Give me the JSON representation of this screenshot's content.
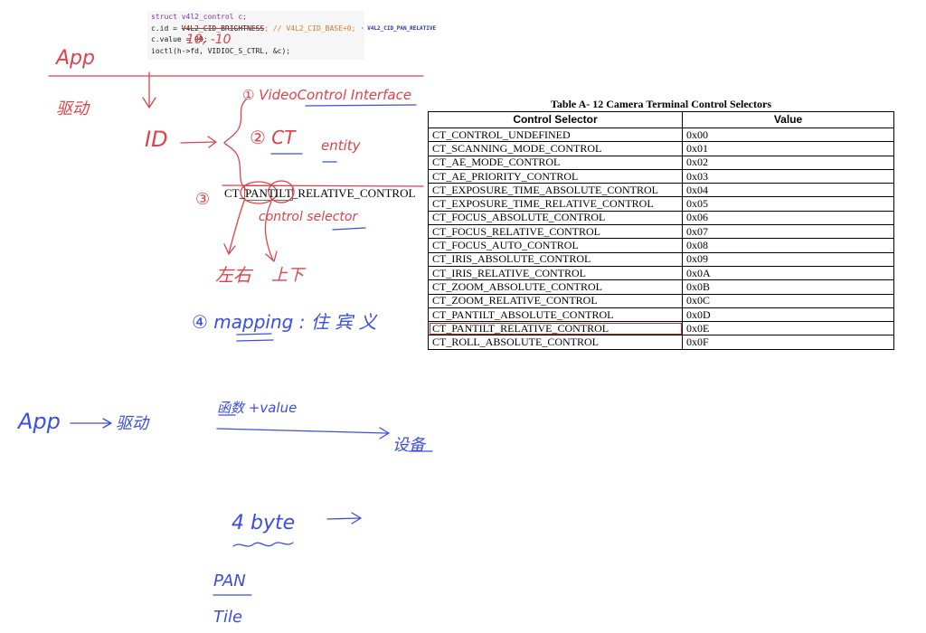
{
  "code": {
    "line1_kw": "struct v4l2_control c;",
    "line2_pre": "c.id = ",
    "line2_strike": "V4L2_CID_BRIGHTNESS",
    "line2_cmt": "; // V4L2_CID_BASE+0;",
    "line3_pre": "c.value = ",
    "line3_strike": "99",
    "line3_post": ";",
    "line4": "ioctl(h->fd, VIDIOC_S_CTRL, &c);"
  },
  "tag": "· V4L2_CID_PAN_RELATIVE",
  "handwriting": {
    "value_note": "10, -10",
    "app_top": "App",
    "driver": "驱动",
    "id": "ID",
    "vc_interface": "① VideoControl Interface",
    "ct_entity_num": "② CT",
    "entity": "entity",
    "num3": "③",
    "control_selector": "control selector",
    "left_right": "左右",
    "up_down": "上下",
    "mapping": "④ mapping : 住 宾 义",
    "app_bottom": "App",
    "driver_bottom": "驱动",
    "func_value": "函数 +value",
    "device": "设备",
    "four_byte": "4 byte",
    "pan": "PAN",
    "tilt": "Tile"
  },
  "ct_label": {
    "pre": "CT_",
    "boxed": "PANTILT",
    "post": "_RELATIVE_CONTROL"
  },
  "table": {
    "title": "Table A- 12 Camera Terminal Control Selectors",
    "headers": [
      "Control Selector",
      "Value"
    ],
    "rows": [
      [
        "CT_CONTROL_UNDEFINED",
        "0x00"
      ],
      [
        "CT_SCANNING_MODE_CONTROL",
        "0x01"
      ],
      [
        "CT_AE_MODE_CONTROL",
        "0x02"
      ],
      [
        "CT_AE_PRIORITY_CONTROL",
        "0x03"
      ],
      [
        "CT_EXPOSURE_TIME_ABSOLUTE_CONTROL",
        "0x04"
      ],
      [
        "CT_EXPOSURE_TIME_RELATIVE_CONTROL",
        "0x05"
      ],
      [
        "CT_FOCUS_ABSOLUTE_CONTROL",
        "0x06"
      ],
      [
        "CT_FOCUS_RELATIVE_CONTROL",
        "0x07"
      ],
      [
        "CT_FOCUS_AUTO_CONTROL",
        "0x08"
      ],
      [
        "CT_IRIS_ABSOLUTE_CONTROL",
        "0x09"
      ],
      [
        "CT_IRIS_RELATIVE_CONTROL",
        "0x0A"
      ],
      [
        "CT_ZOOM_ABSOLUTE_CONTROL",
        "0x0B"
      ],
      [
        "CT_ZOOM_RELATIVE_CONTROL",
        "0x0C"
      ],
      [
        "CT_PANTILT_ABSOLUTE_CONTROL",
        "0x0D"
      ],
      [
        "CT_PANTILT_RELATIVE_CONTROL",
        "0x0E"
      ],
      [
        "CT_ROLL_ABSOLUTE_CONTROL",
        "0x0F"
      ]
    ],
    "highlight_row": 14
  },
  "colors": {
    "red_ink": "#e0424a",
    "blue_ink": "#3b4ee0"
  }
}
